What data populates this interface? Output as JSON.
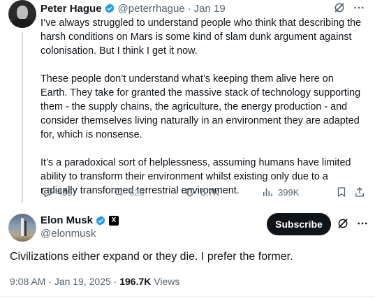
{
  "parent_tweet": {
    "author_name": "Peter Hague",
    "handle": "@peterrhague",
    "separator": "·",
    "date": "Jan 19",
    "paragraphs": [
      "I’ve always struggled to understand people who think that describing the harsh conditions on Mars is some kind of slam dunk argument against colonisation. But I think I get it now.",
      "These people don’t understand what’s keeping them alive here on Earth. They take for granted the massive stack of technology supporting them - the supply chains, the agriculture, the energy production - and consider themselves living naturally in an environment they are adapted for, which is nonsense.",
      "It’s a paradoxical sort of helplessness, assuming humans have limited ability to transform their environment whilst existing only due to a radically transformed terrestrial environment."
    ],
    "actions": {
      "replies": "459",
      "reposts": "623",
      "likes": "6.7K",
      "views": "399K"
    }
  },
  "main_tweet": {
    "author_name": "Elon Musk",
    "handle": "@elonmusk",
    "badge": "X",
    "subscribe_label": "Subscribe",
    "text": "Civilizations either expand or they die. I prefer the former.",
    "timestamp": "9:08 AM · Jan 19, 2025",
    "meta_separator": " · ",
    "views_count": "196.7K",
    "views_label": " Views"
  },
  "icons": {
    "verified": "verified-badge-icon",
    "grok": "grok-icon",
    "more": "more-icon",
    "reply": "reply-icon",
    "repost": "repost-icon",
    "like": "heart-icon",
    "views": "analytics-icon",
    "bookmark": "bookmark-icon",
    "share": "share-icon"
  },
  "colors": {
    "verified_blue": "#1d9bf0",
    "secondary_text": "#536471",
    "subscribe_bg": "#0f1419"
  }
}
